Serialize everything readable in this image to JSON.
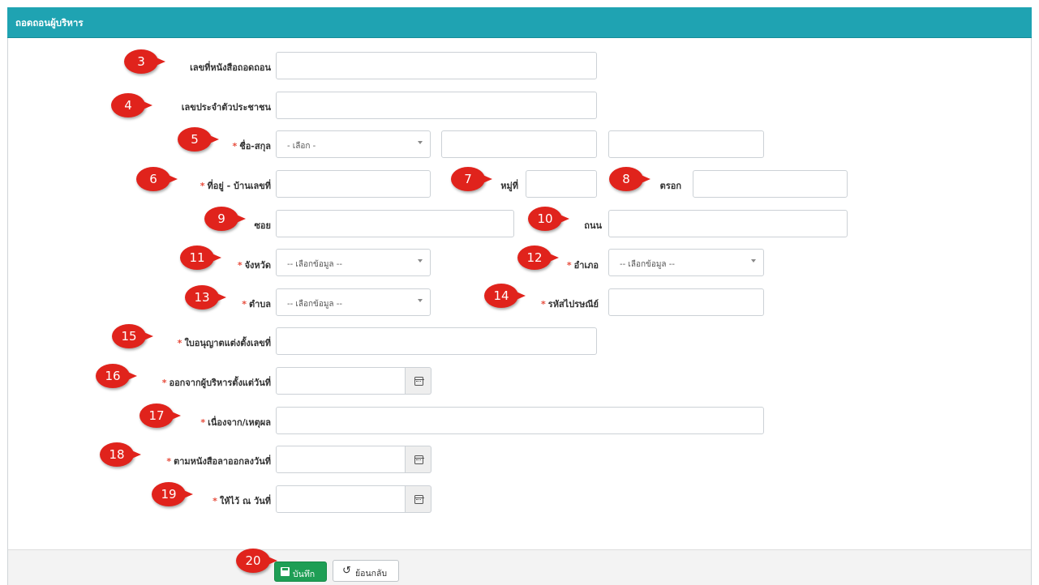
{
  "header": {
    "title": "ถอดถอนผู้บริหาร"
  },
  "fields": {
    "doc_no": {
      "label": "เลขที่หนังสือถอดถอน",
      "value": ""
    },
    "citizen_id": {
      "label": "เลขประจำตัวประชาชน",
      "value": ""
    },
    "name": {
      "label": "ชื่อ-สกุล",
      "prefix_selected": "- เลือก -",
      "first": "",
      "last": ""
    },
    "house_no": {
      "label": "ที่อยู่ - บ้านเลขที่",
      "value": ""
    },
    "moo": {
      "label": "หมู่ที่",
      "value": ""
    },
    "trok": {
      "label": "ตรอก",
      "value": ""
    },
    "soi": {
      "label": "ซอย",
      "value": ""
    },
    "road": {
      "label": "ถนน",
      "value": ""
    },
    "province": {
      "label": "จังหวัด",
      "selected": "-- เลือกข้อมูล --"
    },
    "district": {
      "label": "อำเภอ",
      "selected": "-- เลือกข้อมูล --"
    },
    "subdistrict": {
      "label": "ตำบล",
      "selected": "-- เลือกข้อมูล --"
    },
    "postcode": {
      "label": "รหัสไปรษณีย์",
      "value": ""
    },
    "license_no": {
      "label": "ใบอนุญาตแต่งตั้งเลขที่",
      "value": ""
    },
    "exit_date": {
      "label": "ออกจากผู้บริหารตั้งแต่วันที่",
      "value": ""
    },
    "reason": {
      "label": "เนื่องจาก/เหตุผล",
      "value": ""
    },
    "resign_letter_date": {
      "label": "ตามหนังสือลาออกลงวันที่",
      "value": ""
    },
    "effective_date": {
      "label": "ให้ไว้ ณ วันที่",
      "value": ""
    }
  },
  "required_mark": "*",
  "badges": [
    "3",
    "4",
    "5",
    "6",
    "7",
    "8",
    "9",
    "10",
    "11",
    "12",
    "13",
    "14",
    "15",
    "16",
    "17",
    "18",
    "19",
    "20"
  ],
  "footer": {
    "save_label": "บันทึก",
    "back_label": "ย้อนกลับ",
    "back_icon": "↺"
  },
  "colors": {
    "header": "#1fa3b2",
    "badge": "#e0231c",
    "save": "#1e9e55",
    "required": "#e74c3c"
  }
}
